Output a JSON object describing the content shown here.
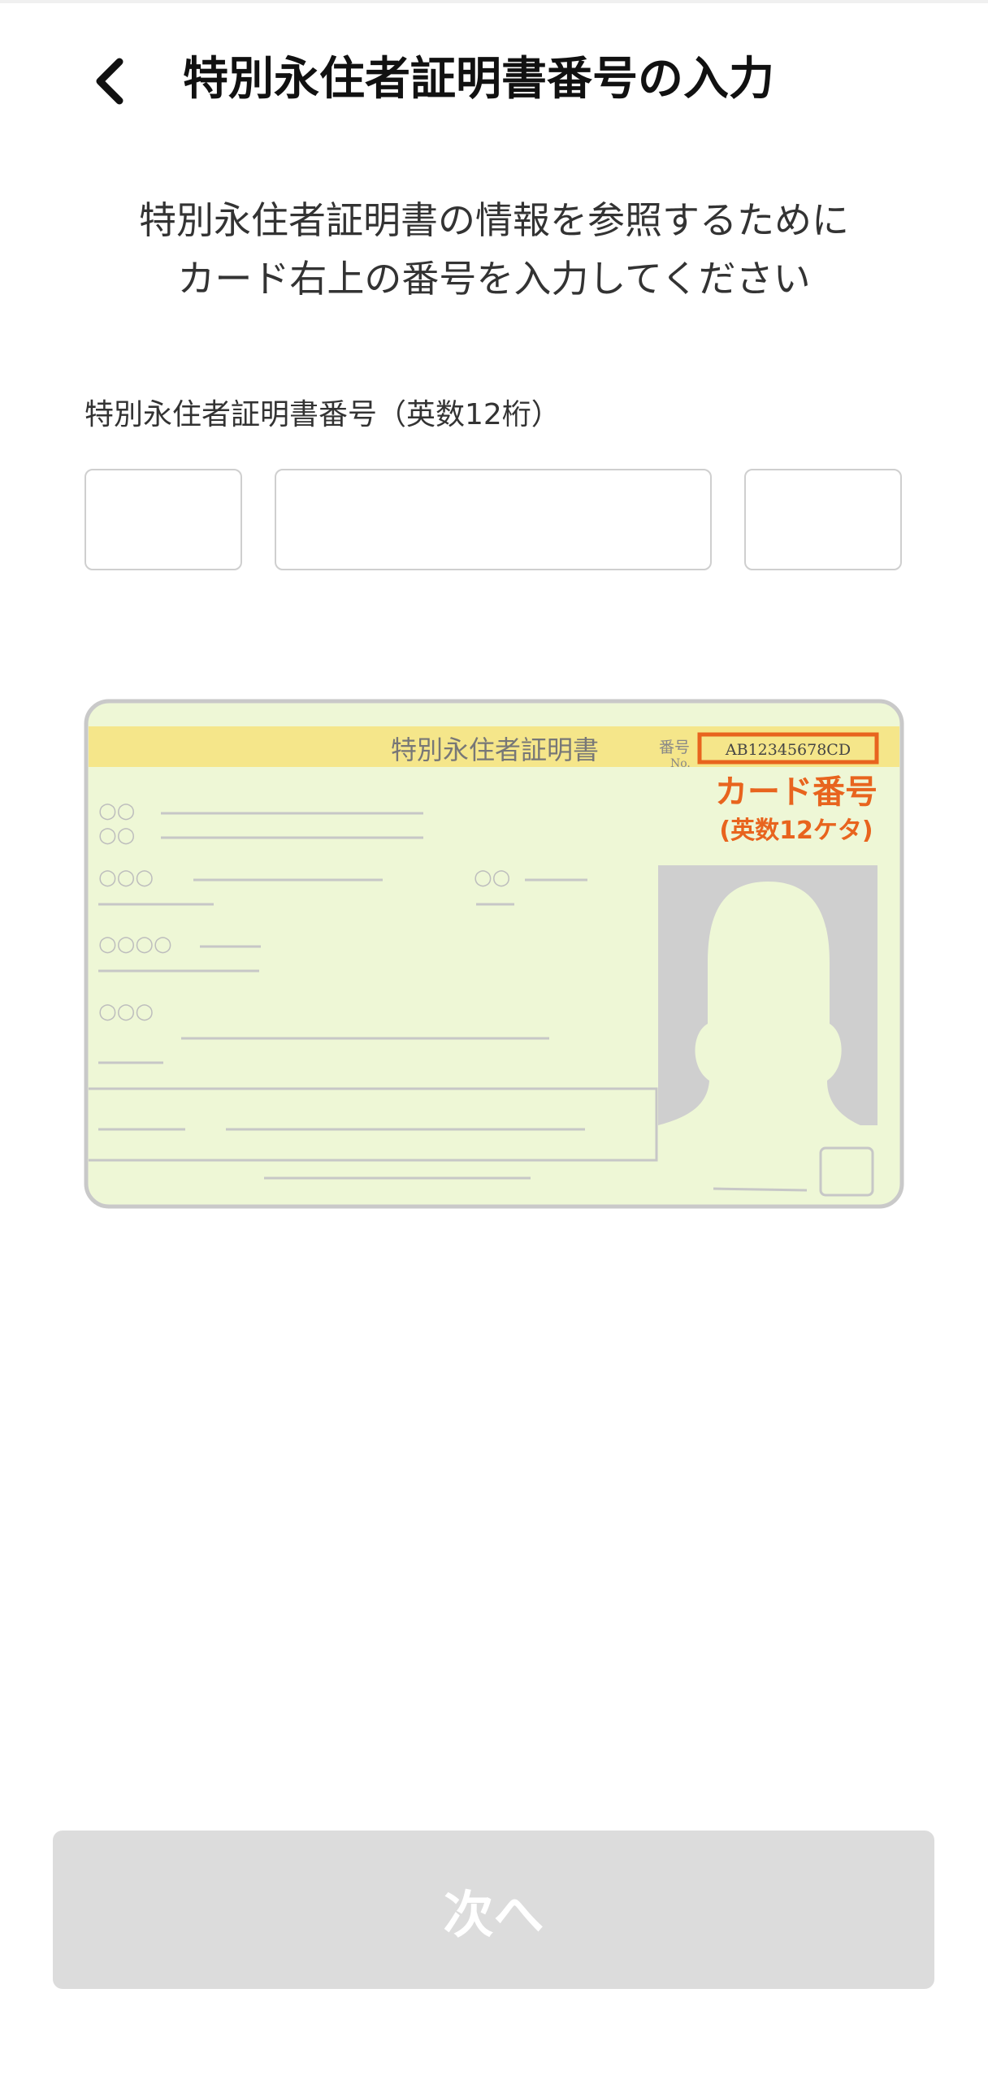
{
  "header": {
    "title": "特別永住者証明書番号の入力"
  },
  "description": {
    "line1": "特別永住者証明書の情報を参照するために",
    "line2": "カード右上の番号を入力してください"
  },
  "form": {
    "label": "特別永住者証明書番号（英数12桁）",
    "segment1_value": "",
    "segment2_value": "",
    "segment3_value": ""
  },
  "card_illustration": {
    "card_title": "特別永住者証明書",
    "number_label": "番号",
    "number_label_en": "No.",
    "sample_number": "AB12345678CD",
    "callout_title": "カード番号",
    "callout_subtitle": "(英数12ケタ)",
    "marks_row1": "○○",
    "marks_row2": "○○",
    "marks_row3": "○○○",
    "marks_row3b": "○○",
    "marks_row4": "○○○○",
    "marks_row5": "○○○"
  },
  "footer": {
    "next_label": "次へ",
    "next_enabled": false
  },
  "colors": {
    "card_background": "#eef7d6",
    "card_band": "#f5e68a",
    "accent_orange": "#e8641e",
    "photo_gray": "#cfcfcf",
    "button_disabled": "#dcdcdc"
  }
}
